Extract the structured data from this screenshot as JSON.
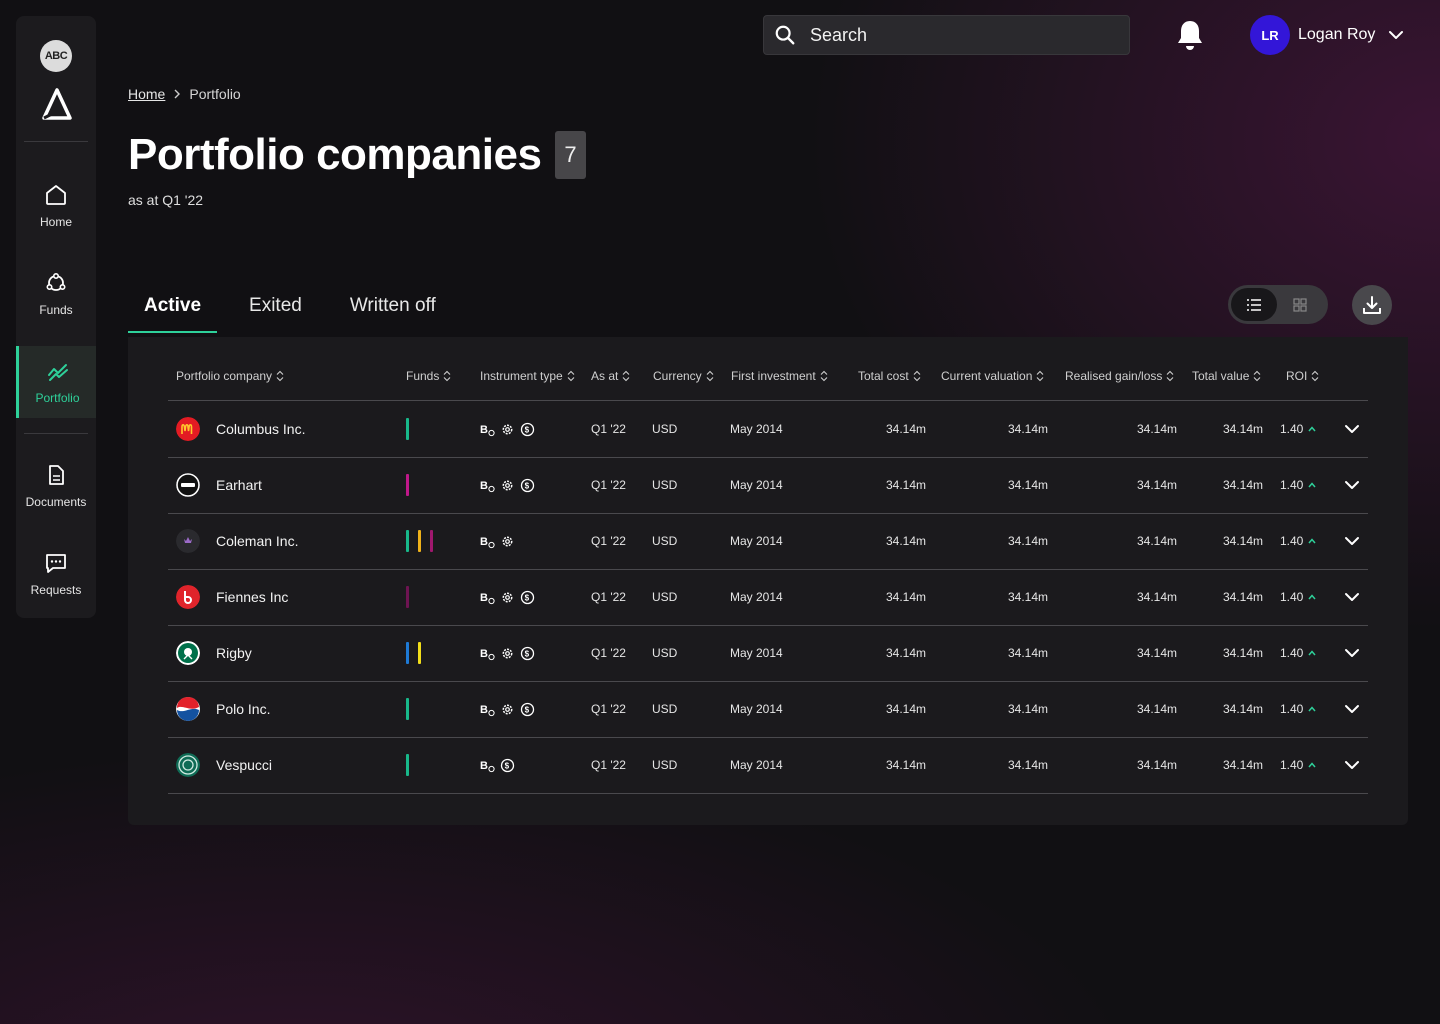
{
  "brand": {
    "badge": "ABC"
  },
  "sidebar": {
    "items": [
      {
        "label": "Home",
        "icon": "home-icon"
      },
      {
        "label": "Funds",
        "icon": "funds-icon"
      },
      {
        "label": "Portfolio",
        "icon": "portfolio-icon"
      },
      {
        "label": "Documents",
        "icon": "document-icon"
      },
      {
        "label": "Requests",
        "icon": "chat-icon"
      }
    ]
  },
  "header": {
    "search_placeholder": "Search",
    "user": {
      "initials": "LR",
      "name": "Logan Roy"
    }
  },
  "breadcrumb": {
    "home": "Home",
    "current": "Portfolio"
  },
  "page": {
    "title": "Portfolio companies",
    "count": "7",
    "subtitle": "as at Q1 '22"
  },
  "tabs": [
    {
      "label": "Active"
    },
    {
      "label": "Exited"
    },
    {
      "label": "Written off"
    }
  ],
  "table": {
    "columns": [
      "Portfolio company",
      "Funds",
      "Instrument type",
      "As at",
      "Currency",
      "First investment",
      "Total cost",
      "Current valuation",
      "Realised gain/loss",
      "Total value",
      "ROI"
    ],
    "rows": [
      {
        "company": "Columbus Inc.",
        "funds": [
          "#18b88a"
        ],
        "instruments": [
          "bond",
          "gear",
          "coin"
        ],
        "as_at": "Q1 '22",
        "currency": "USD",
        "first_investment": "May 2014",
        "total_cost": "34.14m",
        "current_valuation": "34.14m",
        "realised": "34.14m",
        "total_value": "34.14m",
        "roi": "1.40"
      },
      {
        "company": "Earhart",
        "funds": [
          "#c0188a"
        ],
        "instruments": [
          "bond",
          "gear",
          "coin"
        ],
        "as_at": "Q1 '22",
        "currency": "USD",
        "first_investment": "May 2014",
        "total_cost": "34.14m",
        "current_valuation": "34.14m",
        "realised": "34.14m",
        "total_value": "34.14m",
        "roi": "1.40"
      },
      {
        "company": "Coleman Inc.",
        "funds": [
          "#18b88a",
          "#f0b21a",
          "#a0186e"
        ],
        "instruments": [
          "bond",
          "gear"
        ],
        "as_at": "Q1 '22",
        "currency": "USD",
        "first_investment": "May 2014",
        "total_cost": "34.14m",
        "current_valuation": "34.14m",
        "realised": "34.14m",
        "total_value": "34.14m",
        "roi": "1.40"
      },
      {
        "company": "Fiennes Inc",
        "funds": [
          "#6e1452"
        ],
        "instruments": [
          "bond",
          "gear",
          "coin"
        ],
        "as_at": "Q1 '22",
        "currency": "USD",
        "first_investment": "May 2014",
        "total_cost": "34.14m",
        "current_valuation": "34.14m",
        "realised": "34.14m",
        "total_value": "34.14m",
        "roi": "1.40"
      },
      {
        "company": "Rigby",
        "funds": [
          "#1e7ad6",
          "#f2de1a"
        ],
        "instruments": [
          "bond",
          "gear",
          "coin"
        ],
        "as_at": "Q1 '22",
        "currency": "USD",
        "first_investment": "May 2014",
        "total_cost": "34.14m",
        "current_valuation": "34.14m",
        "realised": "34.14m",
        "total_value": "34.14m",
        "roi": "1.40"
      },
      {
        "company": "Polo Inc.",
        "funds": [
          "#18b88a"
        ],
        "instruments": [
          "bond",
          "gear",
          "coin"
        ],
        "as_at": "Q1 '22",
        "currency": "USD",
        "first_investment": "May 2014",
        "total_cost": "34.14m",
        "current_valuation": "34.14m",
        "realised": "34.14m",
        "total_value": "34.14m",
        "roi": "1.40"
      },
      {
        "company": "Vespucci",
        "funds": [
          "#18b88a"
        ],
        "instruments": [
          "bond",
          "coin"
        ],
        "as_at": "Q1 '22",
        "currency": "USD",
        "first_investment": "May 2014",
        "total_cost": "34.14m",
        "current_valuation": "34.14m",
        "realised": "34.14m",
        "total_value": "34.14m",
        "roi": "1.40"
      }
    ]
  },
  "colors": {
    "accent": "#2ed19a",
    "roi_up": "#2ed19a",
    "avatar": "#3316d8"
  }
}
